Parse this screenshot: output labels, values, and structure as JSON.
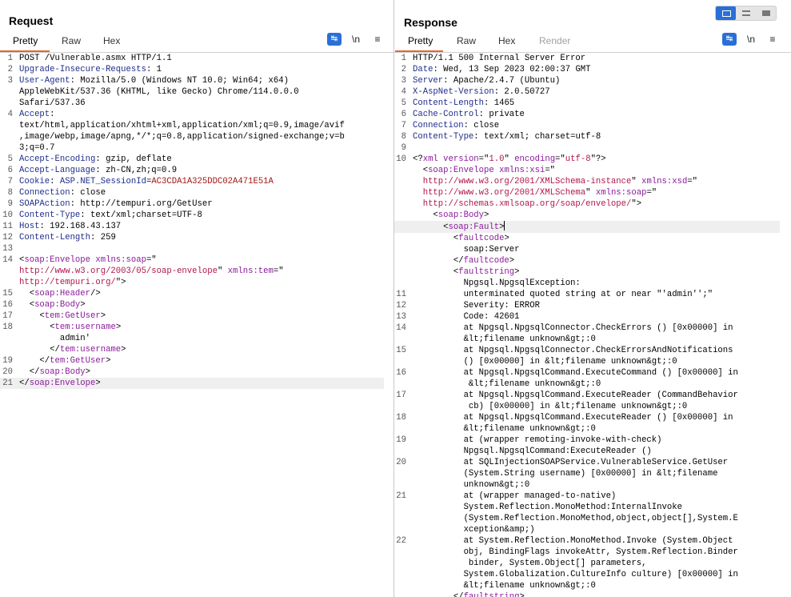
{
  "request": {
    "title": "Request",
    "tabs": [
      "Pretty",
      "Raw",
      "Hex"
    ],
    "lines": [
      {
        "n": "1",
        "t": "POST /Vulnerable.asmx HTTP/1.1"
      },
      {
        "n": "2",
        "h": "Upgrade-Insecure-Requests",
        "v": " 1"
      },
      {
        "n": "3",
        "h": "User-Agent",
        "v": " Mozilla/5.0 (Windows NT 10.0; Win64; x64)"
      },
      {
        "n": "",
        "t": "AppleWebKit/537.36 (KHTML, like Gecko) Chrome/114.0.0.0"
      },
      {
        "n": "",
        "t": "Safari/537.36"
      },
      {
        "n": "4",
        "h": "Accept",
        "v": ""
      },
      {
        "n": "",
        "t": "text/html,application/xhtml+xml,application/xml;q=0.9,image/avif"
      },
      {
        "n": "",
        "t": ",image/webp,image/apng,*/*;q=0.8,application/signed-exchange;v=b"
      },
      {
        "n": "",
        "t": "3;q=0.7"
      },
      {
        "n": "5",
        "h": "Accept-Encoding",
        "v": " gzip, deflate"
      },
      {
        "n": "6",
        "h": "Accept-Language",
        "v": " zh-CN,zh;q=0.9"
      },
      {
        "n": "7",
        "h": "Cookie",
        "v": " ",
        "ck": "ASP.NET_SessionId",
        "cv": "AC3CDA1A325DDC02A471E51A"
      },
      {
        "n": "8",
        "h": "Connection",
        "v": " close"
      },
      {
        "n": "9",
        "h": "SOAPAction",
        "v": " http://tempuri.org/GetUser"
      },
      {
        "n": "10",
        "h": "Content-Type",
        "v": " text/xml;charset=UTF-8"
      },
      {
        "n": "11",
        "h": "Host",
        "v": " 192.168.43.137"
      },
      {
        "n": "12",
        "h": "Content-Length",
        "v": " 259"
      },
      {
        "n": "13",
        "t": ""
      },
      {
        "n": "14",
        "x": [
          [
            "p",
            "<"
          ],
          [
            "tag",
            "soap:Envelope"
          ],
          [
            "p",
            " "
          ],
          [
            "attr",
            "xmlns:soap"
          ],
          [
            "p",
            "=\""
          ]
        ]
      },
      {
        "n": "",
        "x": [
          [
            "val",
            "http://www.w3.org/2003/05/soap-envelope"
          ],
          [
            "p",
            "\" "
          ],
          [
            "attr",
            "xmlns:tem"
          ],
          [
            "p",
            "=\""
          ]
        ]
      },
      {
        "n": "",
        "x": [
          [
            "val",
            "http://tempuri.org/"
          ],
          [
            "p",
            "\">"
          ]
        ]
      },
      {
        "n": "15",
        "x": [
          [
            "p",
            "  <"
          ],
          [
            "tag",
            "soap:Header"
          ],
          [
            "p",
            "/>"
          ]
        ]
      },
      {
        "n": "16",
        "x": [
          [
            "p",
            "  <"
          ],
          [
            "tag",
            "soap:Body"
          ],
          [
            "p",
            ">"
          ]
        ]
      },
      {
        "n": "17",
        "x": [
          [
            "p",
            "    <"
          ],
          [
            "tag",
            "tem:GetUser"
          ],
          [
            "p",
            ">"
          ]
        ]
      },
      {
        "n": "18",
        "x": [
          [
            "p",
            "      <"
          ],
          [
            "tag",
            "tem:username"
          ],
          [
            "p",
            ">"
          ]
        ]
      },
      {
        "n": "",
        "t": "        admin'"
      },
      {
        "n": "",
        "x": [
          [
            "p",
            "      </"
          ],
          [
            "tag",
            "tem:username"
          ],
          [
            "p",
            ">"
          ]
        ]
      },
      {
        "n": "19",
        "x": [
          [
            "p",
            "    </"
          ],
          [
            "tag",
            "tem:GetUser"
          ],
          [
            "p",
            ">"
          ]
        ]
      },
      {
        "n": "20",
        "x": [
          [
            "p",
            "  </"
          ],
          [
            "tag",
            "soap:Body"
          ],
          [
            "p",
            ">"
          ]
        ]
      },
      {
        "n": "21",
        "x": [
          [
            "p",
            "</"
          ],
          [
            "tag",
            "soap:Envelope"
          ],
          [
            "p",
            ">"
          ]
        ],
        "cur": true
      }
    ]
  },
  "response": {
    "title": "Response",
    "tabs": [
      "Pretty",
      "Raw",
      "Hex",
      "Render"
    ],
    "lines": [
      {
        "n": "1",
        "t": "HTTP/1.1 500 Internal Server Error"
      },
      {
        "n": "2",
        "h": "Date",
        "v": " Wed, 13 Sep 2023 02:00:37 GMT"
      },
      {
        "n": "3",
        "h": "Server",
        "v": " Apache/2.4.7 (Ubuntu)"
      },
      {
        "n": "4",
        "h": "X-AspNet-Version",
        "v": " 2.0.50727"
      },
      {
        "n": "5",
        "h": "Content-Length",
        "v": " 1465"
      },
      {
        "n": "6",
        "h": "Cache-Control",
        "v": " private"
      },
      {
        "n": "7",
        "h": "Connection",
        "v": " close"
      },
      {
        "n": "8",
        "h": "Content-Type",
        "v": " text/xml; charset=utf-8"
      },
      {
        "n": "9",
        "t": ""
      },
      {
        "n": "10",
        "x": [
          [
            "p",
            "<?"
          ],
          [
            "tag",
            "xml"
          ],
          [
            "p",
            " "
          ],
          [
            "attr",
            "version"
          ],
          [
            "p",
            "=\""
          ],
          [
            "val",
            "1.0"
          ],
          [
            "p",
            "\" "
          ],
          [
            "attr",
            "encoding"
          ],
          [
            "p",
            "=\""
          ],
          [
            "val",
            "utf-8"
          ],
          [
            "p",
            "\"?>"
          ]
        ]
      },
      {
        "n": "",
        "x": [
          [
            "p",
            "  <"
          ],
          [
            "tag",
            "soap:Envelope"
          ],
          [
            "p",
            " "
          ],
          [
            "attr",
            "xmlns:xsi"
          ],
          [
            "p",
            "=\""
          ]
        ]
      },
      {
        "n": "",
        "x": [
          [
            "val",
            "  http://www.w3.org/2001/XMLSchema-instance"
          ],
          [
            "p",
            "\" "
          ],
          [
            "attr",
            "xmlns:xsd"
          ],
          [
            "p",
            "=\""
          ]
        ]
      },
      {
        "n": "",
        "x": [
          [
            "val",
            "  http://www.w3.org/2001/XMLSchema"
          ],
          [
            "p",
            "\" "
          ],
          [
            "attr",
            "xmlns:soap"
          ],
          [
            "p",
            "=\""
          ]
        ]
      },
      {
        "n": "",
        "x": [
          [
            "val",
            "  http://schemas.xmlsoap.org/soap/envelope/"
          ],
          [
            "p",
            "\">"
          ]
        ]
      },
      {
        "n": "",
        "x": [
          [
            "p",
            "    <"
          ],
          [
            "tag",
            "soap:Body"
          ],
          [
            "p",
            ">"
          ]
        ]
      },
      {
        "n": "",
        "x": [
          [
            "p",
            "      <"
          ],
          [
            "tag",
            "soap:Fault"
          ],
          [
            "p",
            ">"
          ]
        ],
        "cur": true,
        "cursor": true
      },
      {
        "n": "",
        "x": [
          [
            "p",
            "        <"
          ],
          [
            "tag",
            "faultcode"
          ],
          [
            "p",
            ">"
          ]
        ]
      },
      {
        "n": "",
        "t": "          soap:Server"
      },
      {
        "n": "",
        "x": [
          [
            "p",
            "        </"
          ],
          [
            "tag",
            "faultcode"
          ],
          [
            "p",
            ">"
          ]
        ]
      },
      {
        "n": "",
        "x": [
          [
            "p",
            "        <"
          ],
          [
            "tag",
            "faultstring"
          ],
          [
            "p",
            ">"
          ]
        ]
      },
      {
        "n": "",
        "t": "          Npgsql.NpgsqlException:"
      },
      {
        "n": "11",
        "t": "          unterminated quoted string at or near \"'admin'';\""
      },
      {
        "n": "12",
        "t": "          Severity: ERROR"
      },
      {
        "n": "13",
        "t": "          Code: 42601"
      },
      {
        "n": "14",
        "t": "          at Npgsql.NpgsqlConnector.CheckErrors () [0x00000] in"
      },
      {
        "n": "",
        "t": "          &lt;filename unknown&gt;:0"
      },
      {
        "n": "15",
        "t": "          at Npgsql.NpgsqlConnector.CheckErrorsAndNotifications"
      },
      {
        "n": "",
        "t": "          () [0x00000] in &lt;filename unknown&gt;:0"
      },
      {
        "n": "16",
        "t": "          at Npgsql.NpgsqlCommand.ExecuteCommand () [0x00000] in"
      },
      {
        "n": "",
        "t": "           &lt;filename unknown&gt;:0"
      },
      {
        "n": "17",
        "t": "          at Npgsql.NpgsqlCommand.ExecuteReader (CommandBehavior"
      },
      {
        "n": "",
        "t": "           cb) [0x00000] in &lt;filename unknown&gt;:0"
      },
      {
        "n": "18",
        "t": "          at Npgsql.NpgsqlCommand.ExecuteReader () [0x00000] in"
      },
      {
        "n": "",
        "t": "          &lt;filename unknown&gt;:0"
      },
      {
        "n": "19",
        "t": "          at (wrapper remoting-invoke-with-check)"
      },
      {
        "n": "",
        "t": "          Npgsql.NpgsqlCommand:ExecuteReader ()"
      },
      {
        "n": "20",
        "t": "          at SQLInjectionSOAPService.VulnerableService.GetUser"
      },
      {
        "n": "",
        "t": "          (System.String username) [0x00000] in &lt;filename"
      },
      {
        "n": "",
        "t": "          unknown&gt;:0"
      },
      {
        "n": "21",
        "t": "          at (wrapper managed-to-native)"
      },
      {
        "n": "",
        "t": "          System.Reflection.MonoMethod:InternalInvoke"
      },
      {
        "n": "",
        "t": "          (System.Reflection.MonoMethod,object,object[],System.E"
      },
      {
        "n": "",
        "t": "          xception&amp;)"
      },
      {
        "n": "22",
        "t": "          at System.Reflection.MonoMethod.Invoke (System.Object"
      },
      {
        "n": "",
        "t": "          obj, BindingFlags invokeAttr, System.Reflection.Binder"
      },
      {
        "n": "",
        "t": "           binder, System.Object[] parameters,"
      },
      {
        "n": "",
        "t": "          System.Globalization.CultureInfo culture) [0x00000] in"
      },
      {
        "n": "",
        "t": "          &lt;filename unknown&gt;:0"
      },
      {
        "n": "",
        "x": [
          [
            "p",
            "        </"
          ],
          [
            "tag",
            "faultstring"
          ],
          [
            "p",
            ">"
          ]
        ]
      }
    ]
  },
  "toolbar": {
    "wrap_icon": "word-wrap-icon",
    "newline_label": "\\n",
    "menu_icon": "hamburger-menu-icon"
  },
  "layout_switch": {
    "options": [
      "side-by-side-icon",
      "stacked-icon",
      "single-pane-icon"
    ],
    "active": "side-by-side-icon"
  },
  "colors": {
    "accent": "#e8642b",
    "active_button": "#2a6fd6",
    "header_key": "#1f2d8a",
    "xml_tag": "#8a1a9a",
    "xml_value": "#b0174a",
    "cookie_value": "#a31515"
  }
}
